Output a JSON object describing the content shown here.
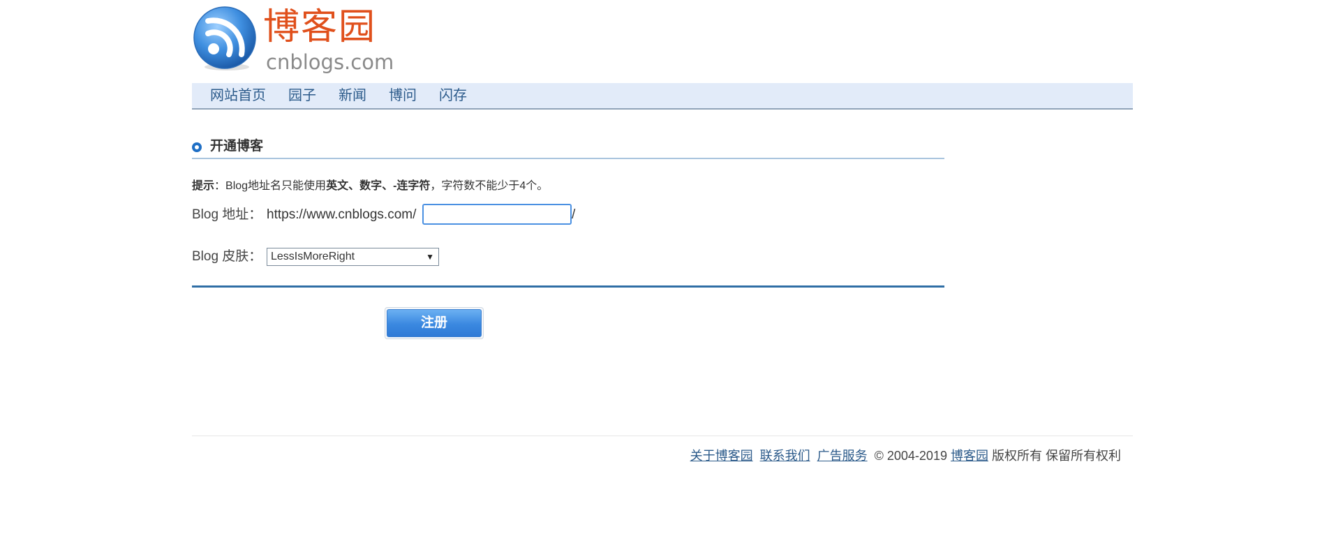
{
  "logo": {
    "cn": "博客园",
    "en": "cnblogs.com"
  },
  "nav": [
    "网站首页",
    "园子",
    "新闻",
    "博问",
    "闪存"
  ],
  "section_title": "开通博客",
  "hint": {
    "label": "提示",
    "colon": "：",
    "text1": "Blog地址名只能使用",
    "strong": "英文、数字、-连字符",
    "text2": "，字符数不能少于4个。"
  },
  "form": {
    "address_label": "Blog 地址：",
    "address_prefix": "https://www.cnblogs.com/",
    "address_value": "",
    "address_suffix": "/",
    "skin_label": "Blog 皮肤：",
    "skin_value": "LessIsMoreRight",
    "submit_label": "注册"
  },
  "footer": {
    "about": "关于博客园",
    "contact": "联系我们",
    "ads": "广告服务",
    "copyright": "© 2004-2019",
    "site": "博客园",
    "rights": "版权所有 保留所有权利"
  },
  "colors": {
    "accent": "#1f6fc5",
    "logo_red": "#e0501c",
    "nav_bg": "#e2ebf9",
    "link": "#2b5a8a"
  }
}
